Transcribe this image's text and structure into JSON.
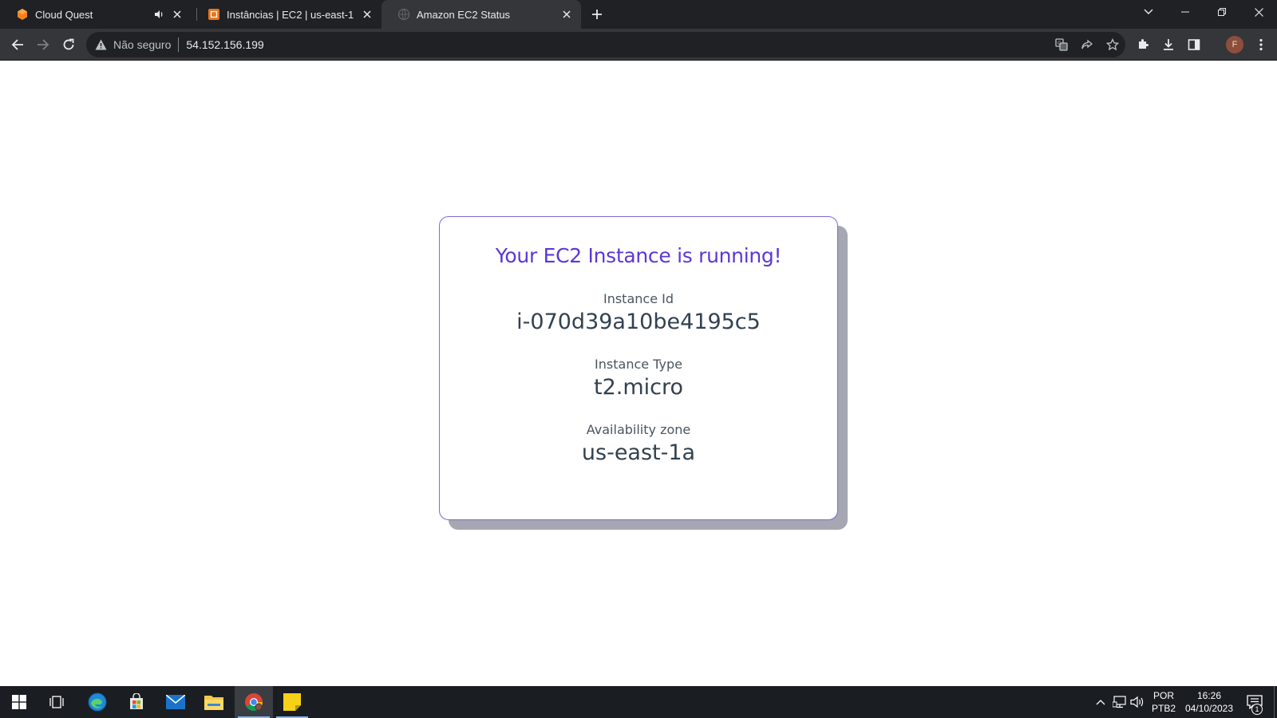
{
  "browser": {
    "tabs": [
      {
        "title": "Cloud Quest",
        "favicon": "cloud-quest-hexagon-icon",
        "audio": true,
        "active": false
      },
      {
        "title": "Instâncias | EC2 | us-east-1",
        "favicon": "aws-ec2-icon",
        "audio": false,
        "active": false
      },
      {
        "title": "Amazon EC2 Status",
        "favicon": "globe-icon",
        "audio": false,
        "active": true
      }
    ],
    "address_bar": {
      "security_label": "Não seguro",
      "url": "54.152.156.199"
    },
    "profile_initial": "F"
  },
  "page": {
    "title": "Your EC2 Instance is running!",
    "fields": [
      {
        "label": "Instance Id",
        "value": "i-070d39a10be4195c5"
      },
      {
        "label": "Instance Type",
        "value": "t2.micro"
      },
      {
        "label": "Availability zone",
        "value": "us-east-1a"
      }
    ]
  },
  "taskbar": {
    "apps": [
      "start-icon",
      "task-view-icon",
      "edge-icon",
      "store-icon",
      "mail-icon",
      "file-explorer-icon",
      "chrome-icon",
      "sticky-notes-icon"
    ],
    "language": {
      "line1": "POR",
      "line2": "PTB2"
    },
    "clock": {
      "time": "16:26",
      "date": "04/10/2023"
    },
    "notification_count": "1"
  },
  "colors": {
    "title_accent": "#5b37d6",
    "card_border": "#7b6ae0",
    "card_shadow": "#a5a7b2",
    "browser_dark": "#202124",
    "toolbar": "#35363a"
  }
}
